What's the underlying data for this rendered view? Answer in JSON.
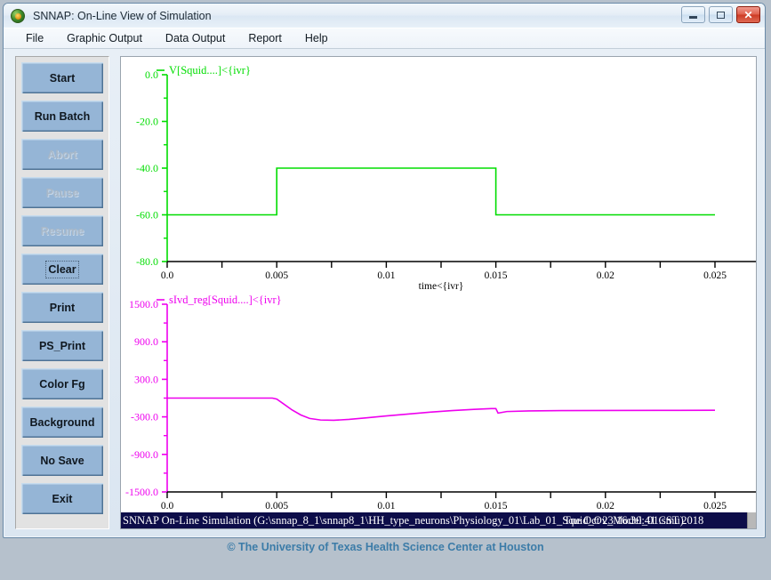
{
  "window": {
    "title": "SNNAP:  On-Line View of Simulation",
    "icon": "snnap-app-icon",
    "controls": {
      "minimize": "minimize-button",
      "maximize": "maximize-button",
      "close_label": "✕"
    }
  },
  "menu": {
    "items": [
      {
        "label": "File"
      },
      {
        "label": "Graphic Output"
      },
      {
        "label": "Data Output"
      },
      {
        "label": "Report"
      },
      {
        "label": "Help"
      }
    ]
  },
  "buttons": [
    {
      "label": "Start",
      "enabled": true,
      "focused": false
    },
    {
      "label": "Run Batch",
      "enabled": true,
      "focused": false
    },
    {
      "label": "Abort",
      "enabled": false,
      "focused": false
    },
    {
      "label": "Pause",
      "enabled": false,
      "focused": false
    },
    {
      "label": "Resume",
      "enabled": false,
      "focused": false
    },
    {
      "label": "Clear",
      "enabled": true,
      "focused": true
    },
    {
      "label": "Print",
      "enabled": true,
      "focused": false
    },
    {
      "label": "PS_Print",
      "enabled": true,
      "focused": false
    },
    {
      "label": "Color Fg",
      "enabled": true,
      "focused": false
    },
    {
      "label": "Background",
      "enabled": true,
      "focused": false
    },
    {
      "label": "No Save",
      "enabled": true,
      "focused": false
    },
    {
      "label": "Exit",
      "enabled": true,
      "focused": false
    }
  ],
  "status": {
    "left_text": "SNNAP On-Line Simulation (G:\\snnap_8_1\\snnap8_1\\HH_type_neurons\\Physiology_01\\Lab_01_Squid_Ov_Model_01.smu)",
    "right_text": "Tue Oct 23 16:30:41 CST 2018"
  },
  "footer": {
    "copyright": "© The University of Texas Health Science Center at Houston"
  },
  "chart_data": [
    {
      "type": "line",
      "title": "V[Squid....]<{ivr}",
      "series_color": "#00dd00",
      "axis_color": "#00dd00",
      "xlabel": "time<{ivr}",
      "ylabel": "",
      "xlim": [
        0.0,
        0.025
      ],
      "ylim": [
        -80.0,
        0.0
      ],
      "xticks": [
        "0.0",
        "0.005",
        "0.01",
        "0.015",
        "0.02",
        "0.025"
      ],
      "xtick_values": [
        0.0,
        0.005,
        0.01,
        0.015,
        0.02,
        0.025
      ],
      "yticks": [
        "0.0",
        "-20.0",
        "-40.0",
        "-60.0",
        "-80.0"
      ],
      "ytick_values": [
        0.0,
        -20.0,
        -40.0,
        -60.0,
        -80.0
      ],
      "minor_tick_step": 10.0,
      "grid": false,
      "legend_position": "top-left",
      "x": [
        0.0,
        0.005,
        0.005,
        0.015,
        0.015,
        0.025
      ],
      "y": [
        -60.0,
        -60.0,
        -40.0,
        -40.0,
        -60.0,
        -60.0
      ]
    },
    {
      "type": "line",
      "title": "sIvd_reg[Squid....]<{ivr}",
      "series_color": "#ee00ee",
      "axis_color": "#ee00ee",
      "xlabel": "time<{ivr}",
      "ylabel": "",
      "xlim": [
        0.0,
        0.025
      ],
      "ylim": [
        -1500.0,
        1500.0
      ],
      "xticks": [
        "0.0",
        "0.005",
        "0.01",
        "0.015",
        "0.02",
        "0.025"
      ],
      "xtick_values": [
        0.0,
        0.005,
        0.01,
        0.015,
        0.02,
        0.025
      ],
      "yticks": [
        "1500.0",
        "900.0",
        "300.0",
        "-300.0",
        "-900.0",
        "-1500.0"
      ],
      "ytick_values": [
        1500.0,
        900.0,
        300.0,
        -300.0,
        -900.0,
        -1500.0
      ],
      "minor_tick_step": 300.0,
      "grid": false,
      "legend_position": "top-left",
      "x": [
        0.0,
        0.0048,
        0.005,
        0.0053,
        0.0057,
        0.0061,
        0.0065,
        0.007,
        0.0076,
        0.0083,
        0.0091,
        0.01,
        0.011,
        0.012,
        0.013,
        0.014,
        0.0148,
        0.015,
        0.0151,
        0.0155,
        0.0165,
        0.018,
        0.02,
        0.0225,
        0.025
      ],
      "y": [
        0,
        0,
        -15,
        -90,
        -190,
        -270,
        -325,
        -350,
        -355,
        -340,
        -315,
        -285,
        -255,
        -225,
        -200,
        -180,
        -168,
        -168,
        -240,
        -215,
        -205,
        -200,
        -198,
        -196,
        -195
      ]
    }
  ]
}
